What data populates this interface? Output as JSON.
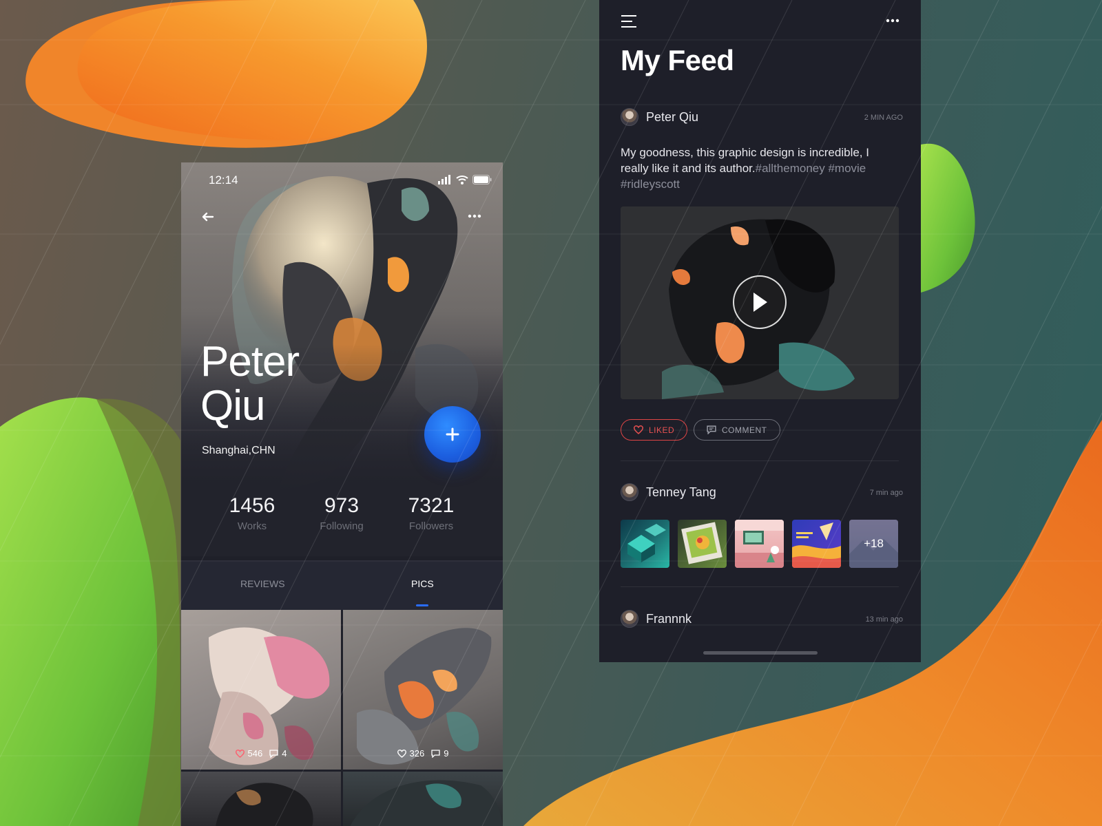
{
  "profile": {
    "status_time": "12:14",
    "name_line1": "Peter",
    "name_line2": "Qiu",
    "location": "Shanghai,CHN",
    "stats": [
      {
        "value": "1456",
        "label": "Works"
      },
      {
        "value": "973",
        "label": "Following"
      },
      {
        "value": "7321",
        "label": "Followers"
      }
    ],
    "tabs": [
      {
        "label": "REVIEWS",
        "active": false
      },
      {
        "label": "PICS",
        "active": true
      }
    ],
    "pics": [
      {
        "likes": "546",
        "comments": "4"
      },
      {
        "likes": "326",
        "comments": "9"
      }
    ],
    "add_label": "+"
  },
  "feed": {
    "title": "My Feed",
    "posts": [
      {
        "author": "Peter Qiu",
        "time": "2 MIN AGO",
        "text": "My goodness, this graphic design is incredible, I really like it and its author.",
        "tags": "#allthemoney #movie #ridleyscott",
        "liked_label": "LIKED",
        "comment_label": "COMMENT"
      },
      {
        "author": "Tenney Tang",
        "time": "7 min ago",
        "more_count": "+18"
      },
      {
        "author": "Frannnk",
        "time": "13 min ago"
      }
    ]
  },
  "colors": {
    "accent_blue": "#2a6dff",
    "liked_red": "#e04545",
    "panel_dark": "#1e1f29",
    "orange_blob": "#f5821f",
    "green_blob": "#7ed33a"
  },
  "icons": [
    "back-arrow-icon",
    "more-dots-icon",
    "menu-icon",
    "signal-icon",
    "wifi-icon",
    "battery-icon",
    "plus-icon",
    "heart-icon",
    "comment-icon",
    "play-icon"
  ]
}
